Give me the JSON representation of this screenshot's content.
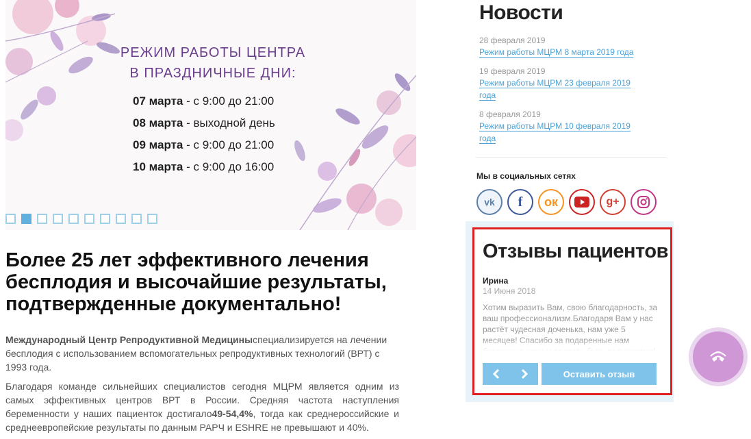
{
  "banner": {
    "heading_line1": "РЕЖИМ РАБОТЫ ЦЕНТРА",
    "heading_line2": "В ПРАЗДНИЧНЫЕ ДНИ:",
    "schedule": [
      {
        "date": "07 марта",
        "text": " - с 9:00 до 21:00"
      },
      {
        "date": "08 марта",
        "text": " - выходной день"
      },
      {
        "date": "09 марта",
        "text": " - с 9:00 до 21:00"
      },
      {
        "date": "10 марта",
        "text": " - с 9:00 до 16:00"
      }
    ],
    "slide_count": 10,
    "active_slide": 2
  },
  "main": {
    "heading": "Более 25 лет эффективного лечения бесплодия и высочайшие результаты, подтвержденные документально!",
    "intro_bold": "Международный Центр Репродуктивной Медицины",
    "intro_text": "специализируется на лечении бесплодия с использованием вспомогательных репродуктивных технологий (ВРТ) с 1993 года.",
    "body_text1": "Благодаря команде сильнейших специалистов сегодня МЦРМ является одним из самых эффективных центров ВРТ в России. Средняя частота наступления беременности у наших пациенток достигало",
    "body_bold": "49-54,4%",
    "body_text2": ", тогда как среднероссийские и среднеевропейские результаты по данным РАРЧ и ESHRE не превышают и 40%."
  },
  "news": {
    "title": "Новости",
    "items": [
      {
        "date": "28 февраля 2019",
        "link": "Режим работы МЦРМ 8 марта 2019 года"
      },
      {
        "date": "19 февраля 2019",
        "link": "Режим работы МЦРМ 23 февраля 2019 года"
      },
      {
        "date": "8 февраля 2019",
        "link": "Режим работы МЦРМ 10 февраля 2019 года"
      }
    ]
  },
  "social": {
    "title": "Мы в социальных сетях",
    "networks": [
      {
        "name": "vk-icon",
        "glyph": "vk"
      },
      {
        "name": "facebook-icon",
        "glyph": "f"
      },
      {
        "name": "odnoklassniki-icon",
        "glyph": "ок"
      },
      {
        "name": "youtube-icon",
        "glyph": ""
      },
      {
        "name": "google-plus-icon",
        "glyph": "g+"
      },
      {
        "name": "instagram-icon",
        "glyph": ""
      }
    ]
  },
  "reviews": {
    "title": "Отзывы пациентов",
    "author": "Ирина",
    "date": "14 Июня 2018",
    "text": "Хотим выразить Вам, свою благодарность, за ваш профессионализм.Благодаря Вам у нас растёт чудесная доченька, нам уже 5 месяцев! Спасибо за подаренные нам бессонные ночи и радость быть родителями!",
    "prev_label": "‹",
    "next_label": "›",
    "leave_button": "Оставить отзыв"
  },
  "colors": {
    "accent_blue": "#7fc3ea",
    "link_blue": "#4aa3d8",
    "highlight_red": "#e02020",
    "banner_purple": "#6a3d8e",
    "call_widget": "#cf97d6"
  }
}
